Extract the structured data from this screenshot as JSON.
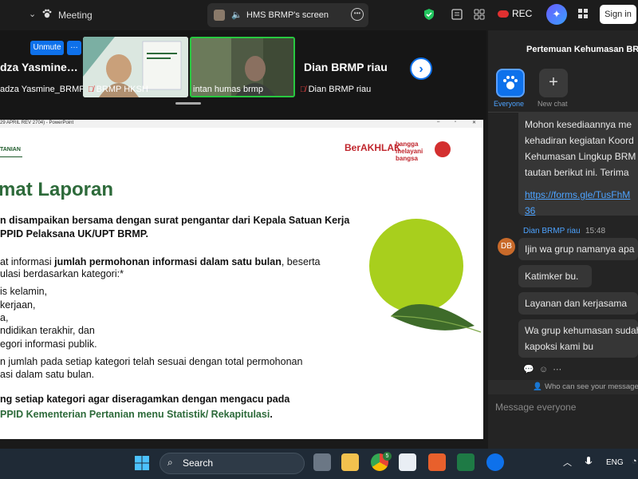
{
  "topbar": {
    "meeting_label": "Meeting",
    "screen_label": "HMS BRMP's screen",
    "rec_label": "REC",
    "signin_label": "Sign in",
    "accent": "#0e71eb"
  },
  "strip": {
    "left_name": "dza  Yasmine…",
    "left_full": "adza Yasmine_BRMP…",
    "unmute_label": "Unmute",
    "vid1_label": "BRMP HKSH",
    "vid2_label": "intan humas brmp",
    "dian_name": "Dian BRMP riau",
    "dian_label": "Dian BRMP riau"
  },
  "slide": {
    "titlebar_text": "29 APRIL REV 2704) - PowerPoint",
    "logo_text": "TANIAN",
    "title": "mat Laporan",
    "lines": [
      {
        "b": true,
        "t": "n disampaikan bersama dengan surat pengantar dari Kepala Satuan Kerja"
      },
      {
        "b": true,
        "t": "PPID Pelaksana UK/UPT BRMP."
      },
      {
        "b": false,
        "t": "at informasi "
      },
      {
        "b": true,
        "t": "jumlah permohonan informasi dalam satu bulan"
      },
      {
        "b": false,
        "t": ", beserta"
      },
      {
        "b": false,
        "t": "ulasi berdasarkan kategori:*"
      },
      {
        "b": false,
        "t": "is kelamin,"
      },
      {
        "b": false,
        "t": "kerjaan,"
      },
      {
        "b": false,
        "t": "a,"
      },
      {
        "b": false,
        "t": "ndidikan terakhir, dan"
      },
      {
        "b": false,
        "t": "egori informasi publik."
      },
      {
        "b": false,
        "t": "n jumlah pada setiap kategori telah sesuai dengan total permohonan"
      },
      {
        "b": false,
        "t": "asi dalam satu bulan."
      },
      {
        "b": true,
        "t": "ng setiap kategori agar diseragamkan dengan mengacu pada"
      },
      {
        "b": true,
        "t": "PPID Kementerian Pertanian menu Statistik/ Rekapitulasi"
      },
      {
        "b": false,
        "t": "."
      }
    ],
    "berakhlak": "BerAKHLAK",
    "bangga": "bangga melayani bangsa"
  },
  "chat": {
    "title": "Pertemuan Kehumasan BRM",
    "everyone_label": "Everyone",
    "newchat_label": "New chat",
    "msg1_lines": [
      "Mohon kesediaannya me",
      "kehadiran kegiatan Koord",
      "Kehumasan Lingkup BRM",
      "tautan berikut ini. Terima"
    ],
    "msg1_link1": "https://forms.gle/TusFhM",
    "msg1_link2": "36",
    "sender_initials": "DB",
    "sender_name": "Dian BRMP riau",
    "sender_time": "15:48",
    "msg2": "Ijin wa grup namanya apa",
    "msg3": "Katimker bu.",
    "msg4": "Layanan dan kerjasama",
    "msg5_l1": "Wa grup kehumasan sudah",
    "msg5_l2": "kapoksi kami bu",
    "who_sees": "Who can see your message",
    "placeholder": "Message everyone"
  },
  "taskbar": {
    "search_label": "Search",
    "lang": "ENG",
    "badge": "5"
  }
}
